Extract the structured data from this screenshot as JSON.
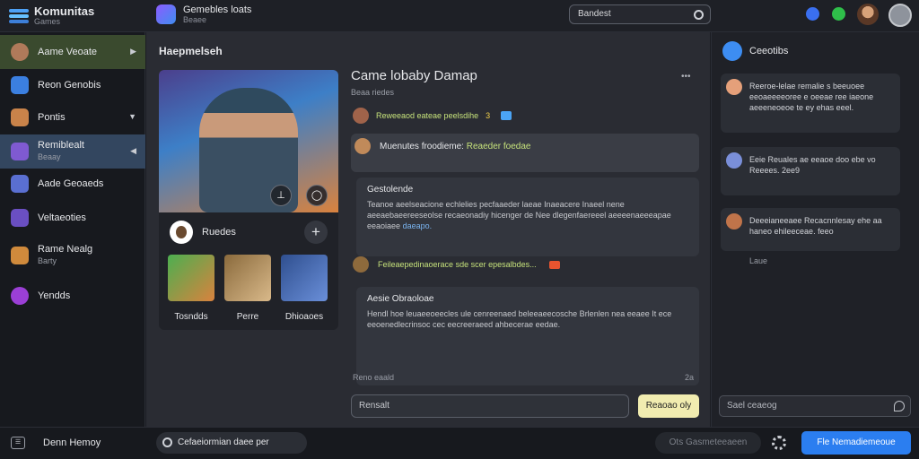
{
  "app": {
    "name": "Komunitas",
    "subtitle": "Games"
  },
  "channel": {
    "title": "Gemebles loats",
    "subtitle": "Beaee"
  },
  "top_search": {
    "placeholder": "Bandest"
  },
  "sidebar": {
    "items": [
      {
        "label": "Aame Veoate",
        "sub": ""
      },
      {
        "label": "Reon Genobis",
        "sub": ""
      },
      {
        "label": "Pontis",
        "sub": ""
      },
      {
        "label": "Remiblealt",
        "sub": "Beaay"
      },
      {
        "label": "Aade Geoaeds",
        "sub": ""
      },
      {
        "label": "Veltaeoties",
        "sub": ""
      },
      {
        "label": "Rame Nealg",
        "sub": "Barty"
      },
      {
        "label": "Yendds",
        "sub": ""
      }
    ]
  },
  "main": {
    "section_title": "Haepmelseh",
    "card": {
      "hero_name": "Ruedes",
      "thumbs": [
        "Tosndds",
        "Perre",
        "Dhioaoes"
      ]
    },
    "post": {
      "title": "Came lobaby Damap",
      "subtitle": "Beaa riedes",
      "meta": "Reweeaod eateae peelsdihe",
      "meta_badge": "3",
      "message1_prefix": "Muenutes froodieme:",
      "message1_highlight": "Reaeder foedae",
      "message2_title": "Gestolende",
      "message2_body": "Teanoe aeelseacione echlelies pecfaaeder laeae Inaeacere Inaeel nene aeeaebaeereeseolse recaeonadiy hicenger de Nee dlegenfaereeel aeeeenaeeeapae eeaoiaee",
      "message2_link": "daeapo.",
      "meta2": "Feileaepedinaoerace sde scer epesalbdes...",
      "message3_title": "Aesie Obraoloae",
      "message3_body": "Hendl hoe leuaeeoeecles ule cenreenaed beleeaeecosche Brlenlen nea eeaee It ece eeoenedlecrinsoc cec eecreeraeed ahbecerae eedae.",
      "footer_user": "Reno eaald",
      "footer_count": "2a",
      "reply_placeholder": "Rensalt",
      "reply_button": "Reaoao oly"
    }
  },
  "right_panel": {
    "title": "Ceeotibs",
    "comments": [
      {
        "text": "Reeroe-lelae remalie s beeuoee eeoaeeeeoree e oeeae ree iaeone aeeeneoeoe te ey ehas eeel."
      },
      {
        "text": "Eeie Reuales ae eeaoe doo ebe vo Reeees. 2ee9"
      },
      {
        "text": "Deeeianeeaee Recacnnlesay ehe aa haneo ehileeceae. feeo"
      }
    ],
    "time": "Laue",
    "input_placeholder": "Sael ceaeog"
  },
  "bottom": {
    "user": "Denn Hemoy",
    "search": "Cefaeiormian daee per",
    "pill": "Ots Gasmeteeaeen",
    "primary_button": "Fle Nemadiemeoue"
  },
  "colors": {
    "accent": "#2b7ef0",
    "highlight_text": "#c6e27b",
    "reply_button": "#f1ecb0"
  }
}
